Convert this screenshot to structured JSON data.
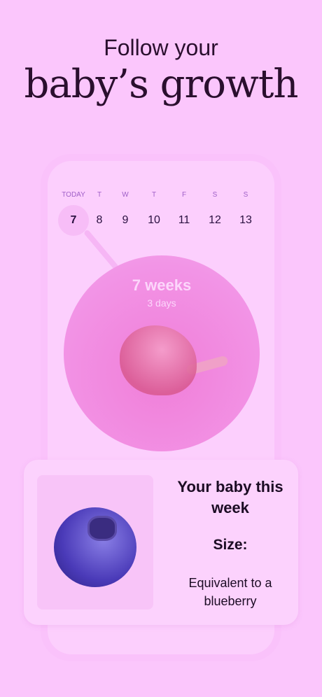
{
  "header": {
    "line1": "Follow your",
    "line2": "baby’s growth"
  },
  "calendar": {
    "days": [
      {
        "label": "TODAY",
        "num": "7"
      },
      {
        "label": "T",
        "num": "8"
      },
      {
        "label": "W",
        "num": "9"
      },
      {
        "label": "T",
        "num": "10"
      },
      {
        "label": "F",
        "num": "11"
      },
      {
        "label": "S",
        "num": "12"
      },
      {
        "label": "S",
        "num": "13"
      }
    ]
  },
  "progress": {
    "weeks": "7 weeks",
    "days": "3 days"
  },
  "card": {
    "title": "Your baby this week",
    "size_label": "Size:",
    "size_value": "Equivalent to a blueberry"
  },
  "colors": {
    "background": "#fbc6fc",
    "circle": "#f294e6",
    "text": "#2a0f2e"
  }
}
